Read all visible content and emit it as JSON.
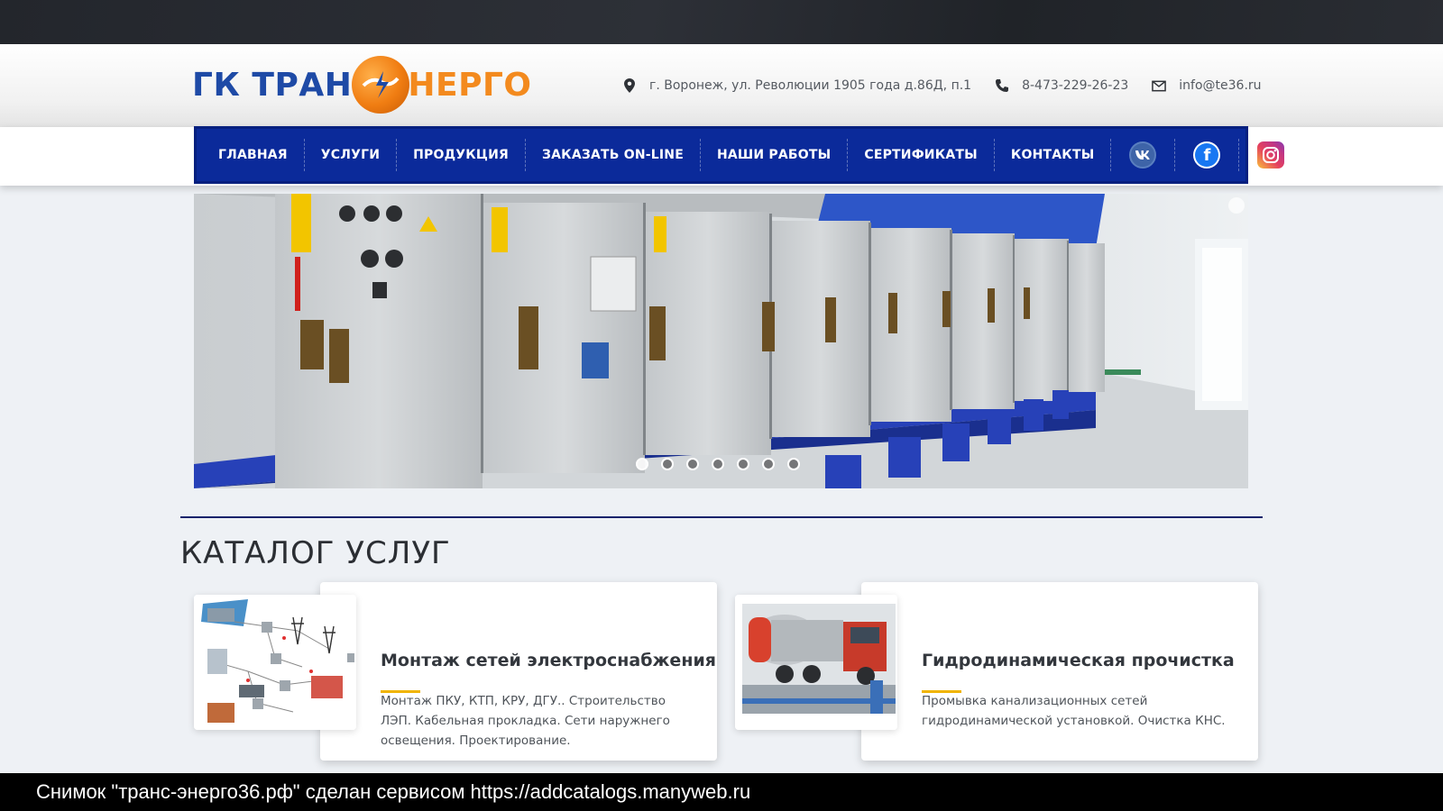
{
  "logo": {
    "part1": "ГК ТРАН",
    "part2": "НЕРГО"
  },
  "contacts": {
    "address": "г. Воронеж, ул. Революции 1905 года д.86Д, п.1",
    "phone": "8-473-229-26-23",
    "email": "info@te36.ru"
  },
  "icons": {
    "address": "map-marker-icon",
    "phone": "phone-icon",
    "email": "envelope-icon",
    "vk": "vk-icon",
    "facebook": "facebook-icon",
    "instagram": "instagram-icon"
  },
  "nav": {
    "items": [
      "ГЛАВНАЯ",
      "УСЛУГИ",
      "ПРОДУКЦИЯ",
      "ЗАКАЗАТЬ ON-LINE",
      "НАШИ РАБОТЫ",
      "СЕРТИФИКАТЫ",
      "КОНТАКТЫ"
    ]
  },
  "slider": {
    "slide_count": 7,
    "active_index": 0
  },
  "catalog": {
    "title": "КАТАЛОГ УСЛУГ",
    "cards": [
      {
        "title": "Монтаж сетей электроснабжения",
        "description": "Монтаж ПКУ, КТП, КРУ, ДГУ.. Строительство ЛЭП. Кабельная прокладка. Сети наружнего освещения. Проектирование."
      },
      {
        "title": "Гидродинамическая прочистка",
        "description": "Промывка канализационных сетей гидродинамической установкой. Очистка КНС."
      }
    ]
  },
  "colors": {
    "nav_bg": "#0b2a9a",
    "logo_blue": "#1e4aa6",
    "logo_orange": "#f38a1e",
    "accent_line": "#f0b400"
  },
  "footer": {
    "caption": "Снимок \"транс-энерго36.рф\" сделан сервисом https://addcatalogs.manyweb.ru"
  }
}
